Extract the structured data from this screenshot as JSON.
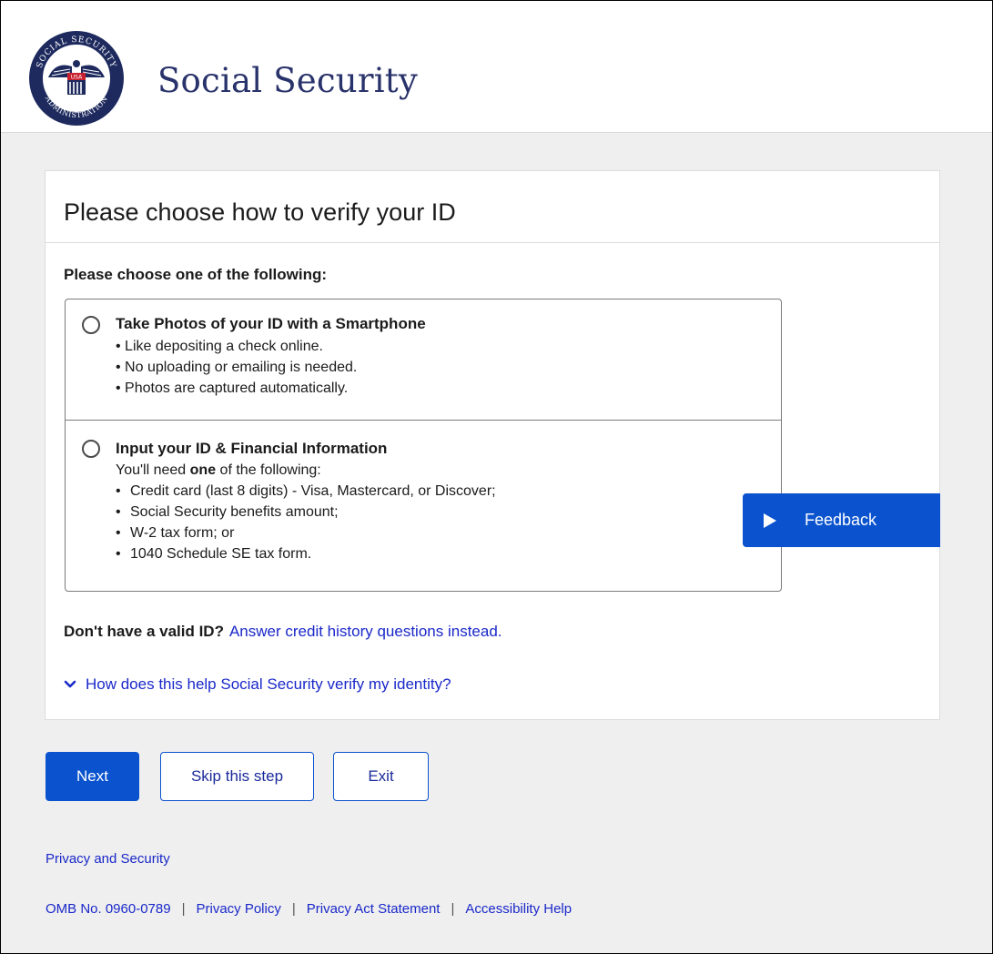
{
  "header": {
    "brand": "Social Security",
    "seal_text_top": "SOCIAL SECURITY",
    "seal_text_bottom": "ADMINISTRATION",
    "seal_badge": "USA"
  },
  "card": {
    "title": "Please choose how to verify your ID",
    "choose_label": "Please choose one of the following:",
    "options": [
      {
        "title": "Take Photos of your ID with a Smartphone",
        "lines": [
          "• Like depositing a check online.",
          "• No uploading or emailing is needed.",
          "• Photos are captured automatically."
        ]
      },
      {
        "title": "Input your ID & Financial Information",
        "need_pre": "You'll need ",
        "need_bold": "one",
        "need_post": " of the following:",
        "bullets": [
          "Credit card (last 8 digits) - Visa, Mastercard, or Discover;",
          "Social Security benefits amount;",
          "W-2 tax form; or",
          "1040 Schedule SE tax form."
        ]
      }
    ],
    "no_id_lead": "Don't have a valid ID?",
    "no_id_link": "Answer credit history questions instead.",
    "how_link": "How does this help Social Security verify my identity?"
  },
  "feedback": {
    "label": "Feedback"
  },
  "buttons": {
    "next": "Next",
    "skip": "Skip this step",
    "exit": "Exit"
  },
  "footer": {
    "privacy_security": "Privacy and Security",
    "omb": "OMB No. 0960-0789",
    "privacy_policy": "Privacy Policy",
    "privacy_act": "Privacy Act Statement",
    "accessibility": "Accessibility Help"
  },
  "colors": {
    "primary": "#0b53ce",
    "link": "#1a28c9",
    "brand_text": "#29336b",
    "background": "#efefef"
  }
}
